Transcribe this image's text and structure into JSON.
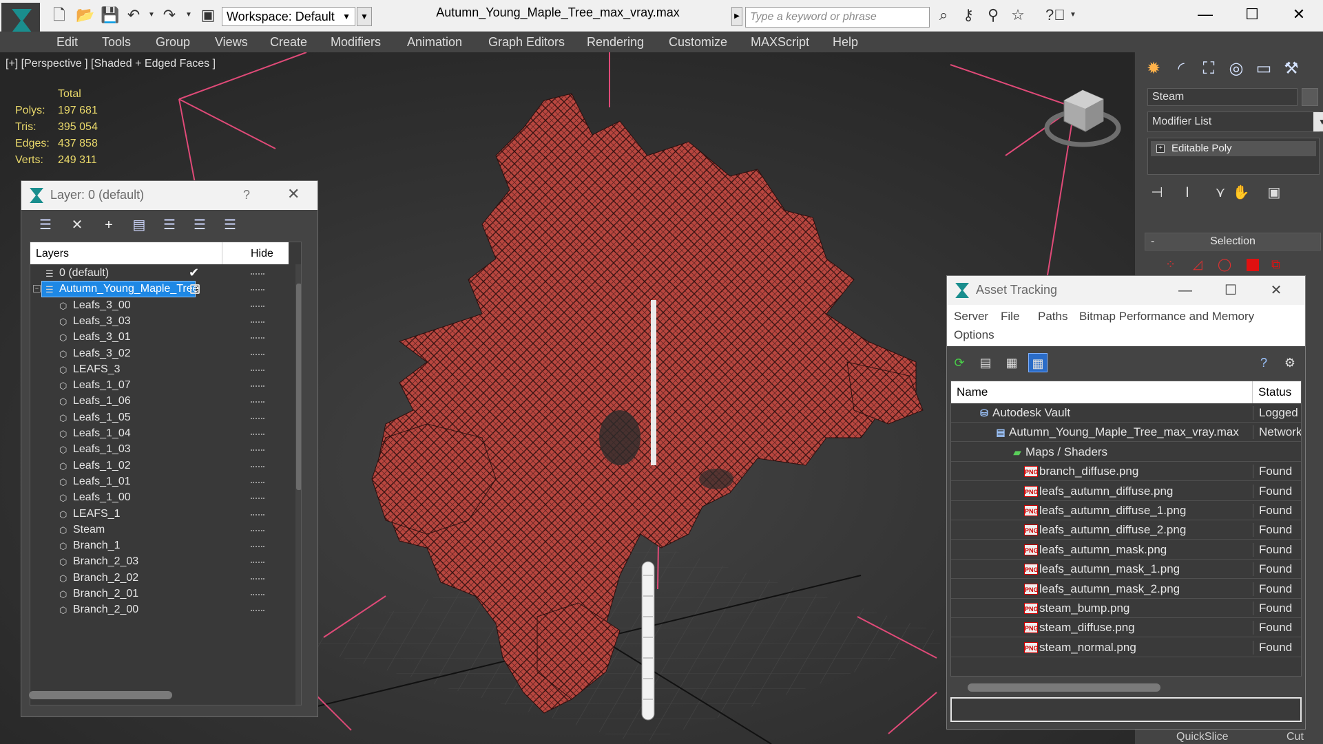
{
  "titlebar": {
    "workspace_label": "Workspace: Default",
    "doc_title": "Autumn_Young_Maple_Tree_max_vray.max",
    "search_placeholder": "Type a keyword or phrase"
  },
  "menu": [
    "Edit",
    "Tools",
    "Group",
    "Views",
    "Create",
    "Modifiers",
    "Animation",
    "Graph Editors",
    "Rendering",
    "Customize",
    "MAXScript",
    "Help"
  ],
  "viewport": {
    "label": "[+] [Perspective ] [Shaded + Edged Faces ]",
    "stats": {
      "header": "Total",
      "polys_label": "Polys:",
      "polys": "197 681",
      "tris_label": "Tris:",
      "tris": "395 054",
      "edges_label": "Edges:",
      "edges": "437 858",
      "verts_label": "Verts:",
      "verts": "249 311"
    }
  },
  "layer_panel": {
    "title": "Layer: 0 (default)",
    "help": "?",
    "col_layers": "Layers",
    "col_hide": "Hide",
    "rows": [
      {
        "label": "0 (default)"
      },
      {
        "label": "Autumn_Young_Maple_Tree"
      },
      {
        "label": "Leafs_3_00"
      },
      {
        "label": "Leafs_3_03"
      },
      {
        "label": "Leafs_3_01"
      },
      {
        "label": "Leafs_3_02"
      },
      {
        "label": "LEAFS_3"
      },
      {
        "label": "Leafs_1_07"
      },
      {
        "label": "Leafs_1_06"
      },
      {
        "label": "Leafs_1_05"
      },
      {
        "label": "Leafs_1_04"
      },
      {
        "label": "Leafs_1_03"
      },
      {
        "label": "Leafs_1_02"
      },
      {
        "label": "Leafs_1_01"
      },
      {
        "label": "Leafs_1_00"
      },
      {
        "label": "LEAFS_1"
      },
      {
        "label": "Steam"
      },
      {
        "label": "Branch_1"
      },
      {
        "label": "Branch_2_03"
      },
      {
        "label": "Branch_2_02"
      },
      {
        "label": "Branch_2_01"
      },
      {
        "label": "Branch_2_00"
      }
    ]
  },
  "command_panel": {
    "object_name": "Steam",
    "modifier_list": "Modifier List",
    "stack_item": "Editable Poly",
    "selection_rollout": "Selection",
    "selection_minus": "-",
    "quickslice": "QuickSlice",
    "cut": "Cut"
  },
  "asset_tracking": {
    "title": "Asset Tracking",
    "menu": [
      "Server",
      "File",
      "Paths",
      "Bitmap Performance and Memory",
      "Options"
    ],
    "col_name": "Name",
    "col_status": "Status",
    "rows": [
      {
        "name": "Autodesk Vault",
        "status": "Logged Out"
      },
      {
        "name": "Autumn_Young_Maple_Tree_max_vray.max",
        "status": "Network"
      },
      {
        "name": "Maps / Shaders",
        "status": ""
      },
      {
        "name": "branch_diffuse.png",
        "status": "Found"
      },
      {
        "name": "leafs_autumn_diffuse.png",
        "status": "Found"
      },
      {
        "name": "leafs_autumn_diffuse_1.png",
        "status": "Found"
      },
      {
        "name": "leafs_autumn_diffuse_2.png",
        "status": "Found"
      },
      {
        "name": "leafs_autumn_mask.png",
        "status": "Found"
      },
      {
        "name": "leafs_autumn_mask_1.png",
        "status": "Found"
      },
      {
        "name": "leafs_autumn_mask_2.png",
        "status": "Found"
      },
      {
        "name": "steam_bump.png",
        "status": "Found"
      },
      {
        "name": "steam_diffuse.png",
        "status": "Found"
      },
      {
        "name": "steam_normal.png",
        "status": "Found"
      }
    ],
    "png_badge": "PNG"
  },
  "colors": {
    "accent": "#1e88e5",
    "tree_leaves": "#b8463f",
    "stats_text": "#e9d86a",
    "gizmo_lines": "#e04a78"
  }
}
